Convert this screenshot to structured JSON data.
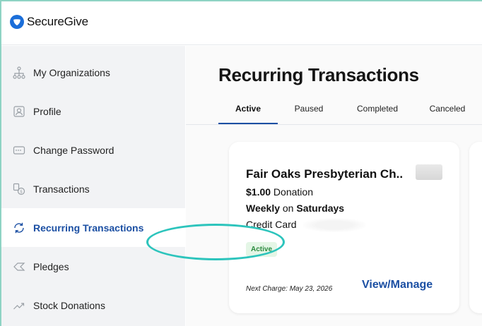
{
  "app": {
    "brand": "SecureGive"
  },
  "colors": {
    "accent": "#1b4fa3",
    "highlight": "#2cc4bc",
    "badge_green": "#2b8a3e"
  },
  "sidebar": {
    "items": [
      {
        "label": "My Organizations",
        "icon": "organization-tree-icon"
      },
      {
        "label": "Profile",
        "icon": "person-icon"
      },
      {
        "label": "Change Password",
        "icon": "password-icon"
      },
      {
        "label": "Transactions",
        "icon": "transactions-icon"
      },
      {
        "label": "Recurring Transactions",
        "icon": "recurring-icon",
        "active": true
      },
      {
        "label": "Pledges",
        "icon": "pledge-icon"
      },
      {
        "label": "Stock Donations",
        "icon": "chart-trend-icon"
      }
    ]
  },
  "main": {
    "title": "Recurring Transactions",
    "tabs": [
      {
        "label": "Active",
        "active": true
      },
      {
        "label": "Paused"
      },
      {
        "label": "Completed"
      },
      {
        "label": "Canceled"
      }
    ],
    "card": {
      "org_name": "Fair Oaks Presbyterian Ch..",
      "amount": "$1.00",
      "amount_suffix": " Donation",
      "frequency": "Weekly",
      "frequency_mid": " on ",
      "frequency_day": "Saturdays",
      "payment_method": "Credit Card",
      "status": "Active",
      "next_charge": "Next Charge: May 23, 2026",
      "action": "View/Manage"
    }
  }
}
